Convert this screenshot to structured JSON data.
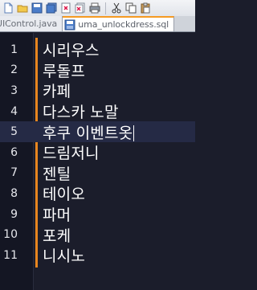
{
  "tabs": [
    {
      "label": "UIControl.java",
      "icon": "java-file-icon",
      "active": false
    },
    {
      "label": "uma_unlockdress.sql",
      "icon": "sql-file-icon",
      "active": true
    }
  ],
  "editor": {
    "current_line": 5,
    "lines": [
      {
        "number": "1",
        "text": "시리우스"
      },
      {
        "number": "2",
        "text": "루돌프"
      },
      {
        "number": "3",
        "text": "카페"
      },
      {
        "number": "4",
        "text": "다스카 노말"
      },
      {
        "number": "5",
        "text": "후쿠 이벤트옷"
      },
      {
        "number": "6",
        "text": "드림저니"
      },
      {
        "number": "7",
        "text": "젠틸"
      },
      {
        "number": "8",
        "text": "테이오"
      },
      {
        "number": "9",
        "text": "파머"
      },
      {
        "number": "10",
        "text": "포케"
      },
      {
        "number": "11",
        "text": "니시노"
      }
    ]
  },
  "colors": {
    "editor_bg": "#1b1d2b",
    "current_line_bg": "#252a45",
    "fold_margin": "#e8861f",
    "active_tab_accent": "#f59a23"
  }
}
